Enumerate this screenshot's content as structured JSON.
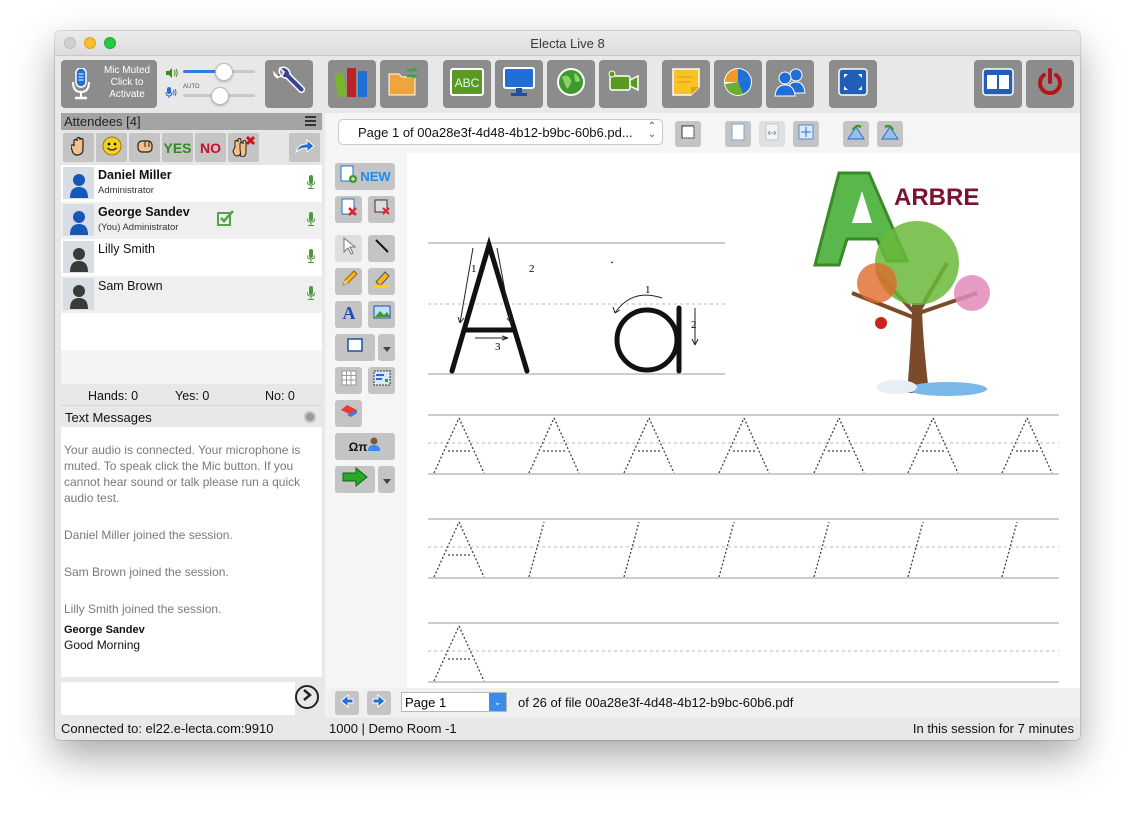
{
  "window": {
    "title": "Electa Live 8"
  },
  "toolbar": {
    "mic": {
      "line1": "Mic Muted",
      "line2": "Click to",
      "line3": "Activate"
    },
    "speaker_volume": 0.55,
    "mic_level": 0.5,
    "mic_auto_label": "AUTO",
    "buttons": [
      {
        "name": "settings",
        "icon": "wrench-icon"
      },
      {
        "name": "library",
        "icon": "books-icon"
      },
      {
        "name": "file-transfer",
        "icon": "folder-transfer-icon"
      },
      {
        "name": "whiteboard",
        "icon": "chalkboard-abc-icon"
      },
      {
        "name": "screen-share",
        "icon": "monitor-icon"
      },
      {
        "name": "web-browser",
        "icon": "globe-icon"
      },
      {
        "name": "video",
        "icon": "video-camera-icon"
      },
      {
        "name": "notes",
        "icon": "sticky-note-icon"
      },
      {
        "name": "polls",
        "icon": "pie-chart-icon"
      },
      {
        "name": "breakout-rooms",
        "icon": "users-icon"
      },
      {
        "name": "fullscreen",
        "icon": "fullscreen-icon"
      },
      {
        "name": "recording",
        "icon": "film-icon"
      },
      {
        "name": "exit",
        "icon": "power-icon"
      }
    ]
  },
  "attendees": {
    "header": "Attendees [4]",
    "responses": [
      {
        "name": "raise-hand",
        "label": "✋"
      },
      {
        "name": "smile",
        "label": "☺"
      },
      {
        "name": "clap",
        "label": "✊"
      },
      {
        "name": "yes",
        "label": "YES"
      },
      {
        "name": "no",
        "label": "NO"
      },
      {
        "name": "clear-hands",
        "label": "✖"
      }
    ],
    "list": [
      {
        "name": "Daniel Miller",
        "role": "Administrator",
        "bold": true,
        "status": "online"
      },
      {
        "name": "George Sandev",
        "role": "(You) Administrator",
        "bold": true,
        "status": "online",
        "checked": true
      },
      {
        "name": "Lilly Smith",
        "role": "",
        "bold": false,
        "status": "participant"
      },
      {
        "name": "Sam Brown",
        "role": "",
        "bold": false,
        "status": "participant"
      }
    ],
    "counts": {
      "hands": "Hands: 0",
      "yes": "Yes: 0",
      "no": "No: 0"
    }
  },
  "messages": {
    "header": "Text Messages",
    "system": [
      "Your audio is connected. Your microphone is muted. To speak click the Mic button. If you cannot hear sound or talk please run a quick audio test.",
      "Daniel Miller joined the session.",
      "Sam Brown joined the session.",
      "Lilly Smith joined the session."
    ],
    "chat": [
      {
        "author": "George Sandev",
        "text": "Good Morning"
      }
    ],
    "input_value": ""
  },
  "document": {
    "selector": "Page 1 of 00a28e3f-4d48-4b12-b9bc-60b6.pd...",
    "page_select": "Page 1",
    "page_info": "of 26 of file 00a28e3f-4d48-4b12-b9bc-60b6.pdf",
    "worksheet_word": "ARBRE",
    "tools": {
      "new_label": "NEW",
      "symbols_label": "Ωπ"
    }
  },
  "status": {
    "connection": "Connected to: el22.e-lecta.com:9910",
    "room": "1000 | Demo Room -1",
    "duration": "In this session for 7 minutes"
  },
  "colors": {
    "accent": "#2a7de1",
    "button_bg": "#8c8c8c",
    "mic_green": "#4a9a3a",
    "yes_green": "#2e8b1e",
    "no_red": "#c8102e"
  }
}
